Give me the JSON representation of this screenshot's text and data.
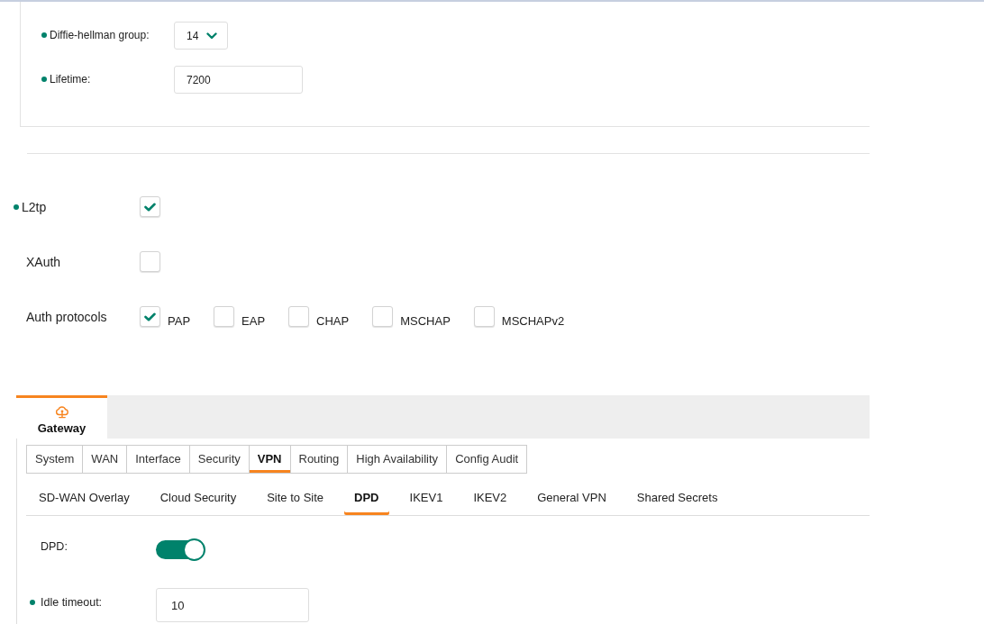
{
  "ike": {
    "fields": [
      {
        "kind": "select",
        "label": "Diffie-hellman group:",
        "required": true,
        "value": "14"
      },
      {
        "kind": "input",
        "label": "Lifetime:",
        "required": true,
        "value": "7200"
      }
    ]
  },
  "l2tp": {
    "rows": [
      {
        "kind": "checkbox",
        "label": "L2tp",
        "required": true,
        "checked": true
      },
      {
        "kind": "checkbox",
        "label": "XAuth",
        "required": false,
        "checked": false
      },
      {
        "kind": "options",
        "label": "Auth protocols",
        "required": false,
        "options": [
          {
            "label": "PAP",
            "checked": true
          },
          {
            "label": "EAP",
            "checked": false
          },
          {
            "label": "CHAP",
            "checked": false
          },
          {
            "label": "MSCHAP",
            "checked": false
          },
          {
            "label": "MSCHAPv2",
            "checked": false
          }
        ]
      }
    ]
  },
  "device_tabs": [
    {
      "label": "Gateway",
      "selected": true
    }
  ],
  "config_tabs": [
    {
      "label": "System",
      "selected": false
    },
    {
      "label": "WAN",
      "selected": false
    },
    {
      "label": "Interface",
      "selected": false
    },
    {
      "label": "Security",
      "selected": false
    },
    {
      "label": "VPN",
      "selected": true
    },
    {
      "label": "Routing",
      "selected": false
    },
    {
      "label": "High Availability",
      "selected": false
    },
    {
      "label": "Config Audit",
      "selected": false
    }
  ],
  "vpn_tabs": [
    {
      "label": "SD-WAN Overlay",
      "selected": false
    },
    {
      "label": "Cloud Security",
      "selected": false
    },
    {
      "label": "Site to Site",
      "selected": false
    },
    {
      "label": "DPD",
      "selected": true
    },
    {
      "label": "IKEV1",
      "selected": false
    },
    {
      "label": "IKEV2",
      "selected": false
    },
    {
      "label": "General VPN",
      "selected": false
    },
    {
      "label": "Shared Secrets",
      "selected": false
    }
  ],
  "dpd": {
    "fields": [
      {
        "kind": "toggle",
        "label": "DPD:",
        "required": false,
        "on": true
      },
      {
        "kind": "input",
        "label": "Idle timeout:",
        "required": true,
        "value": "10"
      }
    ]
  }
}
